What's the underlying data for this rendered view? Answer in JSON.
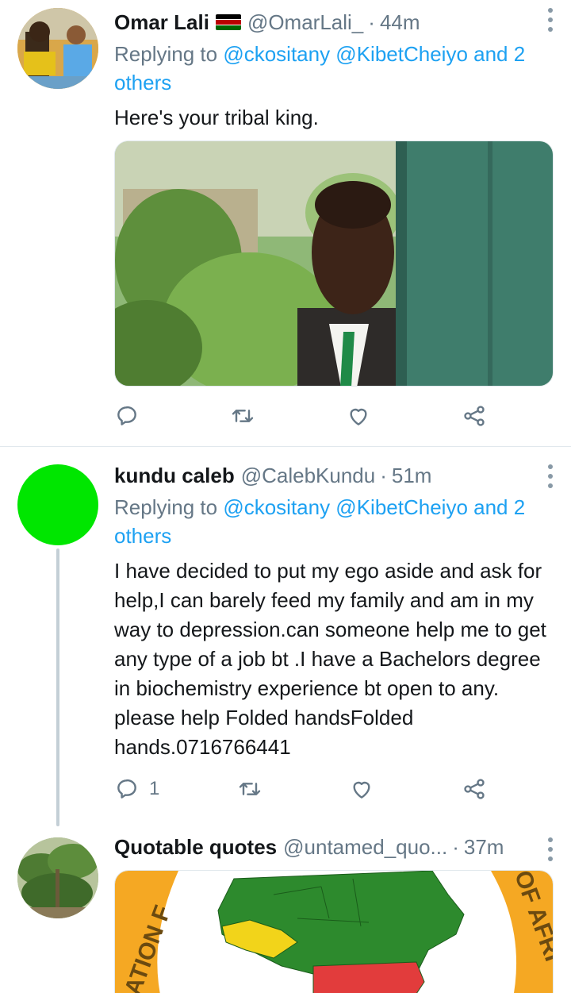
{
  "tweets": [
    {
      "name": "Omar Lali",
      "flag": "kenya-flag",
      "handle": "@OmarLali_",
      "time": "44m",
      "replying_prefix": "Replying to",
      "replying_links": "@ckositany @KibetCheiyo and 2 others",
      "text": "Here's your tribal king.",
      "media": "photo of man peeking from behind a door",
      "actions": {
        "reply_count": "",
        "retweet_count": "",
        "like_count": ""
      }
    },
    {
      "name": "kundu caleb",
      "handle": "@CalebKundu",
      "time": "51m",
      "replying_prefix": "Replying to",
      "replying_links": "@ckositany @KibetCheiyo and 2 others",
      "text": "I have decided to put my ego aside and ask for help,I can barely feed my family and am in my way to depression.can someone help me to get any type of a job bt .I have a Bachelors degree in biochemistry experience bt open to any. please help Folded handsFolded hands.0716766441",
      "actions": {
        "reply_count": "1",
        "retweet_count": "",
        "like_count": ""
      }
    },
    {
      "name": "Quotable quotes",
      "handle": "@untamed_quo...",
      "time": "37m",
      "media_text_left": "ATION F",
      "media_text_right": "OF AFRI"
    }
  ],
  "separator": "·",
  "colors": {
    "link": "#1da1f2",
    "secondary": "#657786",
    "divider": "#e1e8ed",
    "avatar_green": "#00e600"
  }
}
